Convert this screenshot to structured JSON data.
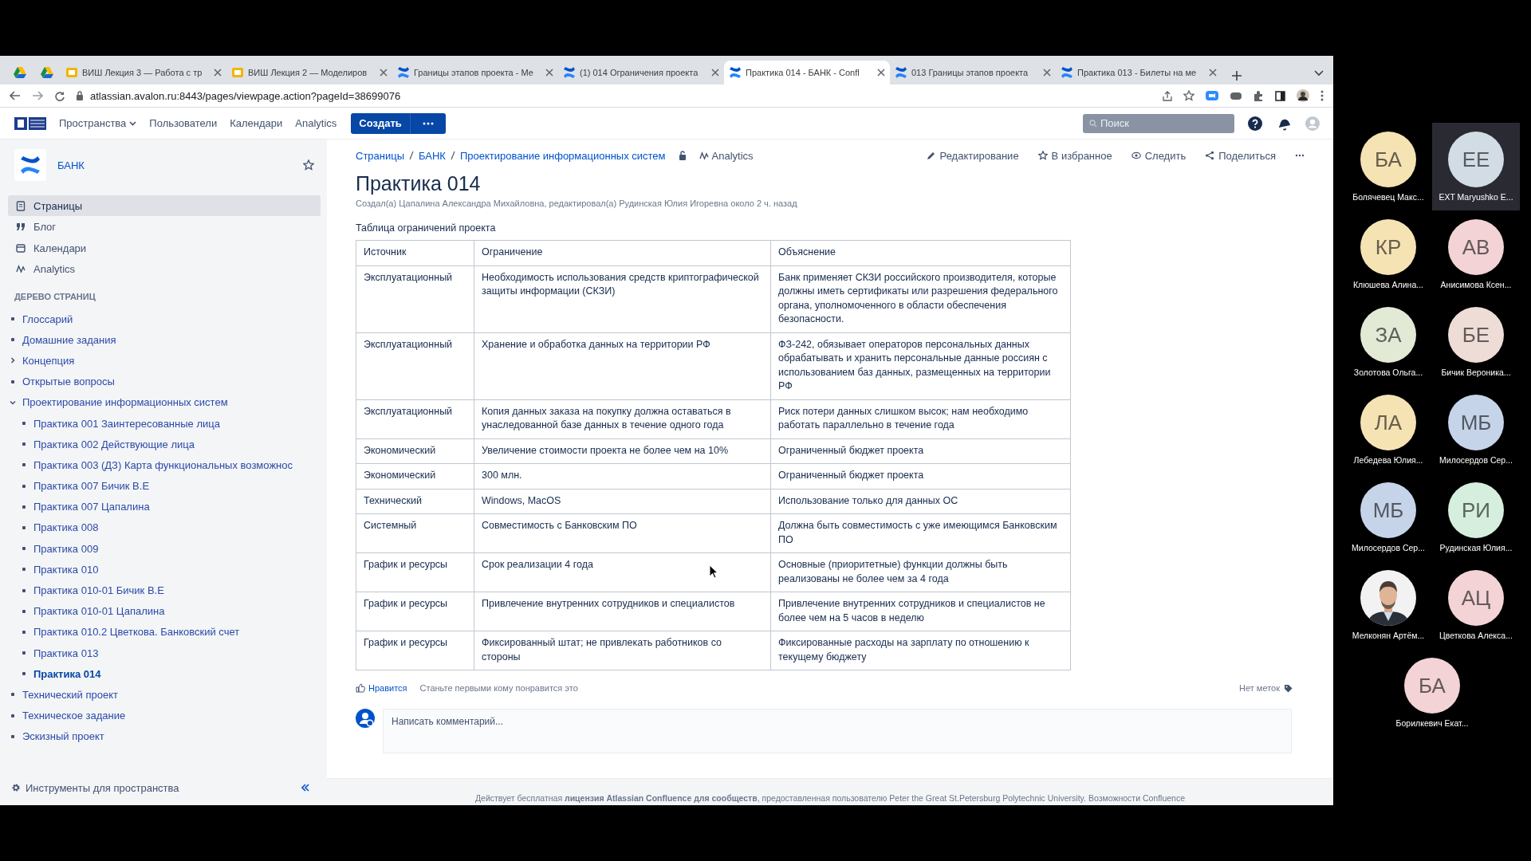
{
  "browser": {
    "tabs": [
      {
        "kind": "drive",
        "selected": false
      },
      {
        "kind": "drive",
        "selected": false
      },
      {
        "kind": "slides",
        "title": "ВИШ Лекция 3 — Работа с тр",
        "selected": false
      },
      {
        "kind": "slides",
        "title": "ВИШ Лекция 2 — Моделиров",
        "selected": false
      },
      {
        "kind": "confluence",
        "title": "Границы этапов проекта - Ме",
        "selected": false
      },
      {
        "kind": "confluence",
        "title": "(1) 014 Ограничения проекта",
        "selected": false
      },
      {
        "kind": "confluence",
        "title": "Практика 014 - БАНК - Confl",
        "selected": true
      },
      {
        "kind": "confluence",
        "title": "013 Границы этапов проекта",
        "selected": false
      },
      {
        "kind": "confluence",
        "title": "Практика 013 - Билеты на ме",
        "selected": false
      }
    ],
    "address": "atlassian.avalon.ru:8443/pages/viewpage.action?pageId=38699076"
  },
  "header": {
    "nav": [
      {
        "label": "Пространства",
        "dropdown": true
      },
      {
        "label": "Пользователи",
        "dropdown": false
      },
      {
        "label": "Календари",
        "dropdown": false
      },
      {
        "label": "Analytics",
        "dropdown": false
      }
    ],
    "create": "Создать",
    "search_placeholder": "Поиск"
  },
  "sidebar": {
    "space": "БАНК",
    "nav": [
      {
        "label": "Страницы",
        "selected": true
      },
      {
        "label": "Блог",
        "selected": false
      },
      {
        "label": "Календари",
        "selected": false
      },
      {
        "label": "Analytics",
        "selected": false
      }
    ],
    "tree_heading": "ДЕРЕВО СТРАНИЦ",
    "tree": [
      {
        "label": "Глоссарий",
        "kind": "page",
        "selected": false
      },
      {
        "label": "Домашние задания",
        "kind": "page",
        "selected": false
      },
      {
        "label": "Концепция",
        "kind": "parent",
        "expanded": false,
        "selected": false
      },
      {
        "label": "Открытые вопросы",
        "kind": "page",
        "selected": false
      },
      {
        "label": "Проектирование информационных систем",
        "kind": "parent",
        "expanded": true,
        "selected": false,
        "children": [
          {
            "label": "Практика 001 Заинтересованные лица",
            "kind": "page",
            "selected": false
          },
          {
            "label": "Практика 002 Действующие лица",
            "kind": "page",
            "selected": false
          },
          {
            "label": "Практика 003 (ДЗ) Карта функциональных возможнос",
            "kind": "page",
            "selected": false
          },
          {
            "label": "Практика 007 Бичик В.Е",
            "kind": "page",
            "selected": false
          },
          {
            "label": "Практика 007 Цапалина",
            "kind": "page",
            "selected": false
          },
          {
            "label": "Практика 008",
            "kind": "page",
            "selected": false
          },
          {
            "label": "Практика 009",
            "kind": "page",
            "selected": false
          },
          {
            "label": "Практика 010",
            "kind": "page",
            "selected": false
          },
          {
            "label": "Практика 010-01 Бичик В.Е",
            "kind": "page",
            "selected": false
          },
          {
            "label": "Практика 010-01 Цапалина",
            "kind": "page",
            "selected": false
          },
          {
            "label": "Практика 010.2 Цветкова. Банковский счет",
            "kind": "page",
            "selected": false
          },
          {
            "label": "Практика 013",
            "kind": "page",
            "selected": false
          },
          {
            "label": "Практика 014",
            "kind": "page",
            "selected": true
          }
        ]
      },
      {
        "label": "Технический проект",
        "kind": "page",
        "selected": false
      },
      {
        "label": "Техническое задание",
        "kind": "page",
        "selected": false
      },
      {
        "label": "Эскизный проект",
        "kind": "page",
        "selected": false
      }
    ],
    "tools": "Инструменты для пространства"
  },
  "page": {
    "breadcrumbs": [
      "Страницы",
      "БАНК",
      "Проектирование информационных систем"
    ],
    "analytics": "Analytics",
    "actions": [
      {
        "label": "Редактирование",
        "kind": "edit"
      },
      {
        "label": "В избранное",
        "kind": "star"
      },
      {
        "label": "Следить",
        "kind": "watch"
      },
      {
        "label": "Поделиться",
        "kind": "share"
      }
    ],
    "title": "Практика 014",
    "byline": "Создал(а) Цапалина Александра Михайловна, редактировал(а) Рудинская Юлия Игоревна около 2 ч. назад",
    "caption": "Таблица ограничений проекта",
    "table": {
      "columns": [
        "Источник",
        "Ограничение",
        "Объяснение"
      ],
      "rows": [
        [
          "Эксплуатационный",
          "Необходимость использования средств криптографической защиты информации (СКЗИ)",
          "Банк применяет СКЗИ российского производителя, которые должны иметь сертификаты или разрешения федерального органа, уполномоченного в области обеспечения безопасности."
        ],
        [
          "Эксплуатационный",
          "Хранение и обработка данных на территории РФ",
          "ФЗ-242, обязывает операторов персональных данных обрабатывать и хранить персональные данные россиян с использованием баз данных, размещенных на территории РФ"
        ],
        [
          "Эксплуатационный",
          "Копия данных заказа на покупку должна оставаться в унаследованной базе данных в течение одного года",
          "Риск потери данных слишком высок; нам необходимо работать параллельно в течение года"
        ],
        [
          "Экономический",
          "Увеличение стоимости проекта не более чем на 10%",
          "Ограниченный бюджет проекта"
        ],
        [
          "Экономический",
          "300 млн.",
          "Ограниченный бюджет проекта"
        ],
        [
          "Технический",
          "Windows, MacOS",
          "Использование только для данных ОС"
        ],
        [
          "Системный",
          "Совместимость с Банковским ПО",
          "Должна быть совместимость с уже имеющимся Банковским ПО"
        ],
        [
          "График и ресурсы",
          "Срок реализации 4 года",
          "Основные (приоритетные) функции должны быть реализованы не более чем за 4 года"
        ],
        [
          "График и ресурсы",
          "Привлечение внутренних сотрудников и специалистов",
          "Привлечение внутренних сотрудников и специалистов не более чем на 5 часов в неделю"
        ],
        [
          "График и ресурсы",
          "Фиксированный штат; не привлекать работников со стороны",
          "Фиксированные расходы на зарплату по отношению к текущему бюджету"
        ]
      ]
    },
    "like": "Нравится",
    "like_hint": "Станьте первыми кому понравится это",
    "labels": "Нет меток",
    "comment_placeholder": "Написать комментарий...",
    "footer": "Действует бесплатная **лицензия Atlassian Confluence для сообществ**, предоставленная пользователю Peter the Great St.Petersburg Polytechnic University. Возможности Confluence"
  },
  "participants": [
    {
      "kind": "initials",
      "initials": "БА",
      "name": "Болячевец Макс...",
      "color": "#f6e3b4",
      "speaking": false
    },
    {
      "kind": "initials",
      "initials": "ЕЕ",
      "name": "EXT Maryushko E...",
      "color": "#d2dce4",
      "speaking": true
    },
    {
      "kind": "initials",
      "initials": "КР",
      "name": "Клюшева Алина...",
      "color": "#f6e3b4",
      "speaking": false
    },
    {
      "kind": "initials",
      "initials": "АВ",
      "name": "Анисимова Ксен...",
      "color": "#f3d3d6",
      "speaking": false
    },
    {
      "kind": "initials",
      "initials": "ЗА",
      "name": "Золотова Ольга...",
      "color": "#e2ead6",
      "speaking": false
    },
    {
      "kind": "initials",
      "initials": "БЕ",
      "name": "Бичик Вероника...",
      "color": "#eedcd6",
      "speaking": false
    },
    {
      "kind": "initials",
      "initials": "ЛА",
      "name": "Лебедева Юлия...",
      "color": "#f6e3b4",
      "speaking": false
    },
    {
      "kind": "initials",
      "initials": "МБ",
      "name": "Милосердов Сер...",
      "color": "#c6d4ea",
      "speaking": false
    },
    {
      "kind": "initials",
      "initials": "МБ",
      "name": "Милосердов Сер...",
      "color": "#c6d4ea",
      "speaking": false
    },
    {
      "kind": "initials",
      "initials": "РИ",
      "name": "Рудинская Юлия...",
      "color": "#d6eedd",
      "speaking": false
    },
    {
      "name": "Мелконян Артём...",
      "speaking": false
    },
    {
      "kind": "initials",
      "initials": "АЦ",
      "name": "Цветкова Алекса...",
      "color": "#f3d3d6",
      "speaking": false
    },
    {
      "kind": "initials",
      "initials": "БА",
      "name": "Борилкевич Екат...",
      "color": "#f3d3d6",
      "speaking": false
    }
  ]
}
